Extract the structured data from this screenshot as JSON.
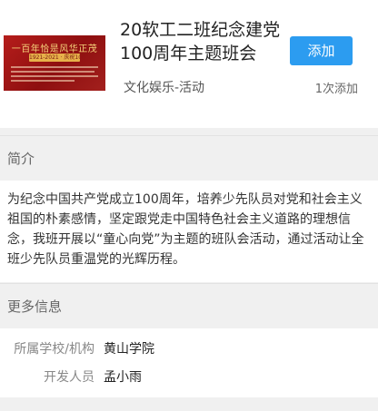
{
  "activity": {
    "title": "20软工二班纪念建党100周年主题班会",
    "category": "文化娱乐-活动",
    "add_button": "添加",
    "add_count": "1次添加",
    "thumbnail": {
      "headline": "一百年恰是风华正茂",
      "subline": "1921-2021 · 庆祝100周年"
    }
  },
  "intro": {
    "header": "简介",
    "text": "为纪念中国共产党成立100周年，培养少先队员对党和社会主义祖国的朴素感情，坚定跟党走中国特色社会主义道路的理想信念，我班开展以“童心向党”为主题的班队会活动，通过活动让全班少先队员重温党的光辉历程。"
  },
  "more_info": {
    "header": "更多信息",
    "school_label": "所属学校/机构",
    "school_value": "黄山学院",
    "developer_label": "开发人员",
    "developer_value": "孟小雨"
  },
  "colors": {
    "accent": "#2c9cf0",
    "banner_red": "#b51d1b"
  }
}
